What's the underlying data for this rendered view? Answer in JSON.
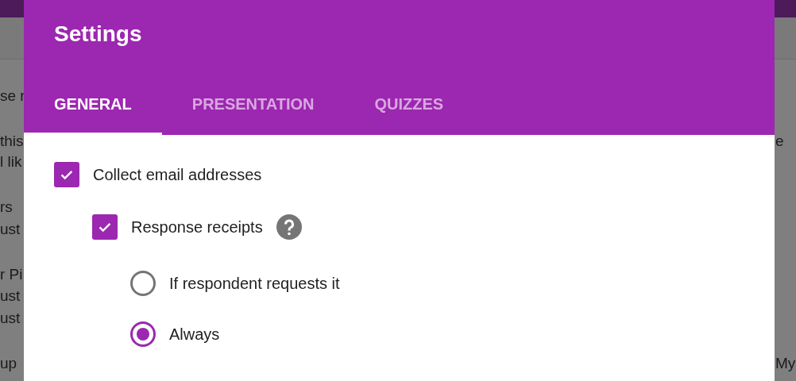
{
  "background": {
    "left_fragments": [
      "se r",
      "this",
      "l lik",
      "rs",
      "ust",
      "r Pi",
      "ust",
      "ust",
      "up"
    ],
    "right_fragments": [
      "e",
      "My"
    ]
  },
  "dialog": {
    "title": "Settings",
    "tabs": [
      {
        "label": "GENERAL",
        "selected": true
      },
      {
        "label": "PRESENTATION",
        "selected": false
      },
      {
        "label": "QUIZZES",
        "selected": false
      }
    ],
    "options": [
      {
        "kind": "checkbox",
        "label": "Collect email addresses",
        "checked": true,
        "help": false,
        "children": [
          {
            "kind": "checkbox",
            "label": "Response receipts",
            "checked": true,
            "help": true,
            "children": [
              {
                "kind": "radio",
                "label": "If respondent requests it",
                "selected": false
              },
              {
                "kind": "radio",
                "label": "Always",
                "selected": true
              }
            ]
          }
        ]
      }
    ]
  }
}
